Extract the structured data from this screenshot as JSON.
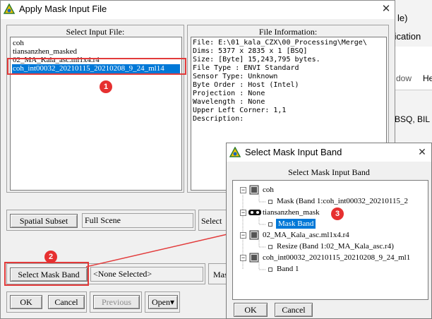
{
  "background_app": {
    "fragments": [
      "le)",
      "fication",
      "dow",
      "He",
      "BSQ, BIL"
    ]
  },
  "main_dialog": {
    "title": "Apply Mask Input File",
    "close_glyph": "✕",
    "select_input_label": "Select Input File:",
    "files": [
      "coh",
      "tiansanzhen_masked",
      "02_MA_Kala_asc.ml1x4.r4",
      "coh_int00032_20210115_20210208_9_24_ml14"
    ],
    "file_info_label": "File Information:",
    "file_info_lines": [
      "File: E:\\01_kala_CZX\\00_Processing\\Merge\\",
      "Dims: 5377 x 2835 x 1 [BSQ]",
      "Size: [Byte] 15,243,795 bytes.",
      "File Type  : ENVI Standard",
      "Sensor Type: Unknown",
      "Byte Order : Host (Intel)",
      "Projection : None",
      "Wavelength : None",
      "Upper Left Corner: 1,1",
      "Description:"
    ],
    "spatial_subset_button": "Spatial Subset",
    "spatial_subset_value": "Full Scene",
    "select_partial_label": "Select",
    "select_mask_band_button": "Select Mask Band",
    "mask_band_value": "<None Selected>",
    "mask_partial_label": "Mas",
    "ok_button": "OK",
    "cancel_button": "Cancel",
    "previous_button": "Previous",
    "open_button": "Open",
    "open_arrow": "▾"
  },
  "band_dialog": {
    "title": "Select Mask Input Band",
    "close_glyph": "✕",
    "header": "Select Mask Input Band",
    "tree": [
      {
        "name": "coh",
        "children": [
          "Mask (Band 1:coh_int00032_20210115_2"
        ]
      },
      {
        "name": "tiansanzhen_mask",
        "children": [
          "Mask Band"
        ]
      },
      {
        "name": "02_MA_Kala_asc.ml1x4.r4",
        "children": [
          "Resize (Band 1:02_MA_Kala_asc.r4)"
        ]
      },
      {
        "name": "coh_int00032_20210115_20210208_9_24_ml1",
        "children": [
          "Band 1"
        ]
      }
    ],
    "expander_glyph": "−",
    "ok_button": "OK",
    "cancel_button": "Cancel"
  },
  "annotations": {
    "badge_1": "1",
    "badge_2": "2",
    "badge_3": "3",
    "accent_red": "#e23b3b",
    "selection_blue": "#0078d7"
  }
}
